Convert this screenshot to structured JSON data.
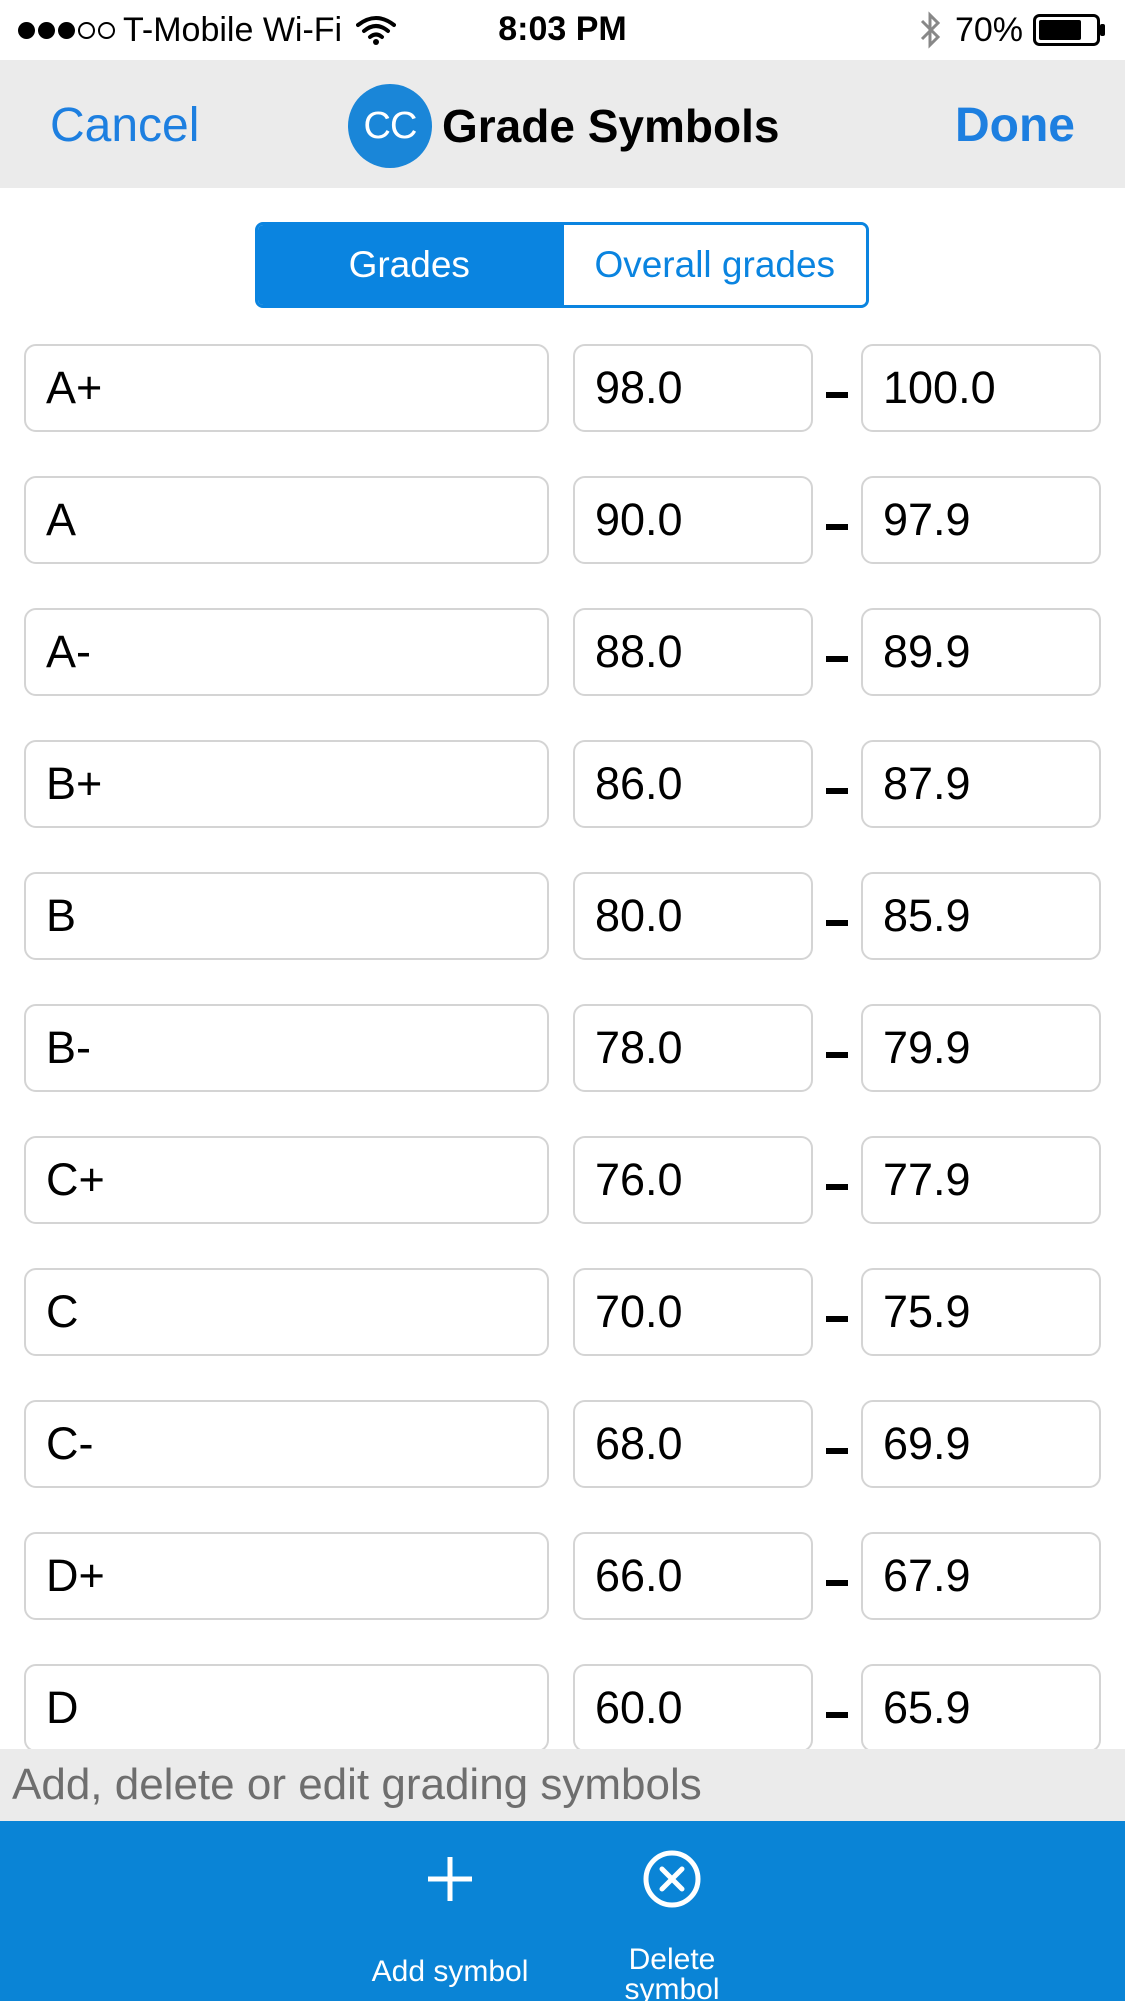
{
  "status_bar": {
    "carrier": "T-Mobile Wi-Fi",
    "time": "8:03 PM",
    "battery_percent": "70%",
    "signal_bars": 3,
    "signal_max": 5
  },
  "nav": {
    "cancel_label": "Cancel",
    "done_label": "Done",
    "logo_text": "CC",
    "title": "Grade Symbols"
  },
  "tabs": [
    {
      "label": "Grades",
      "active": true
    },
    {
      "label": "Overall grades",
      "active": false
    }
  ],
  "grades": [
    {
      "symbol": "A+",
      "low": "98.0",
      "high": "100.0"
    },
    {
      "symbol": "A",
      "low": "90.0",
      "high": "97.9"
    },
    {
      "symbol": "A-",
      "low": "88.0",
      "high": "89.9"
    },
    {
      "symbol": "B+",
      "low": "86.0",
      "high": "87.9"
    },
    {
      "symbol": "B",
      "low": "80.0",
      "high": "85.9"
    },
    {
      "symbol": "B-",
      "low": "78.0",
      "high": "79.9"
    },
    {
      "symbol": "C+",
      "low": "76.0",
      "high": "77.9"
    },
    {
      "symbol": "C",
      "low": "70.0",
      "high": "75.9"
    },
    {
      "symbol": "C-",
      "low": "68.0",
      "high": "69.9"
    },
    {
      "symbol": "D+",
      "low": "66.0",
      "high": "67.9"
    },
    {
      "symbol": "D",
      "low": "60.0",
      "high": "65.9"
    }
  ],
  "hint": "Add, delete or edit grading symbols",
  "toolbar": {
    "add_label": "Add symbol",
    "add_icon": "plus-icon",
    "delete_label_line1": "Delete",
    "delete_label_line2": "symbol",
    "delete_icon": "circle-x-icon"
  },
  "colors": {
    "accent": "#0a84e0",
    "toolbar_bg": "#0a84d6",
    "nav_bg": "#ebebeb",
    "field_border": "#d4d4d4"
  }
}
